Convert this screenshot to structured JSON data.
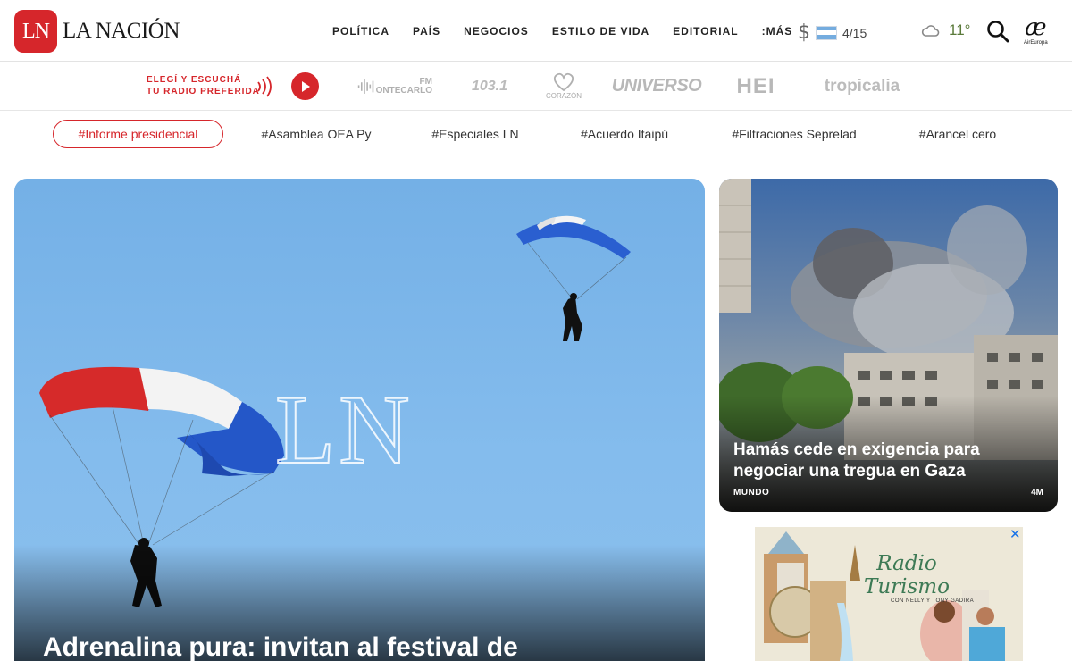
{
  "brand": {
    "logo_initials": "LN",
    "name": "LA NACIÓN"
  },
  "nav": {
    "items": [
      "POLÍTICA",
      "PAÍS",
      "NEGOCIOS",
      "ESTILO DE VIDA",
      "EDITORIAL",
      ":MÁS"
    ]
  },
  "currency": {
    "symbol": "$",
    "value": "4/15"
  },
  "weather": {
    "temperature": "11°"
  },
  "sponsor": {
    "glyph": "æ",
    "label": "AirEuropa"
  },
  "radio": {
    "cta_line1": "ELEGÍ Y ESCUCHÁ",
    "cta_line2": "TU RADIO PREFERIDA",
    "stations": {
      "montecarlo_label": "ONTECARLO",
      "montecarlo_fm": "FM",
      "station_1031": "103.1",
      "corazon": "CORAZÓN",
      "universo": "UNIVERSO",
      "hei": "HEI",
      "tropicalia": "tropicalia"
    }
  },
  "tags": [
    "#Informe presidencial",
    "#Asamblea OEA Py",
    "#Especiales LN",
    "#Acuerdo Itaipú",
    "#Filtraciones Seprelad",
    "#Arancel cero"
  ],
  "hero": {
    "watermark": "LN",
    "title": "Adrenalina pura: invitan al festival de"
  },
  "side_story": {
    "title": "Hamás cede en exigencia para negociar una tregua en Gaza",
    "section": "MUNDO",
    "time": "4M"
  },
  "ad": {
    "close": "✕",
    "title_line1": "Radio",
    "title_line2": "Turismo",
    "subtitle": "CON NELLY Y TONY GADIRA"
  },
  "colors": {
    "brand_red": "#d6262b",
    "sky": "#7fb6ea"
  }
}
